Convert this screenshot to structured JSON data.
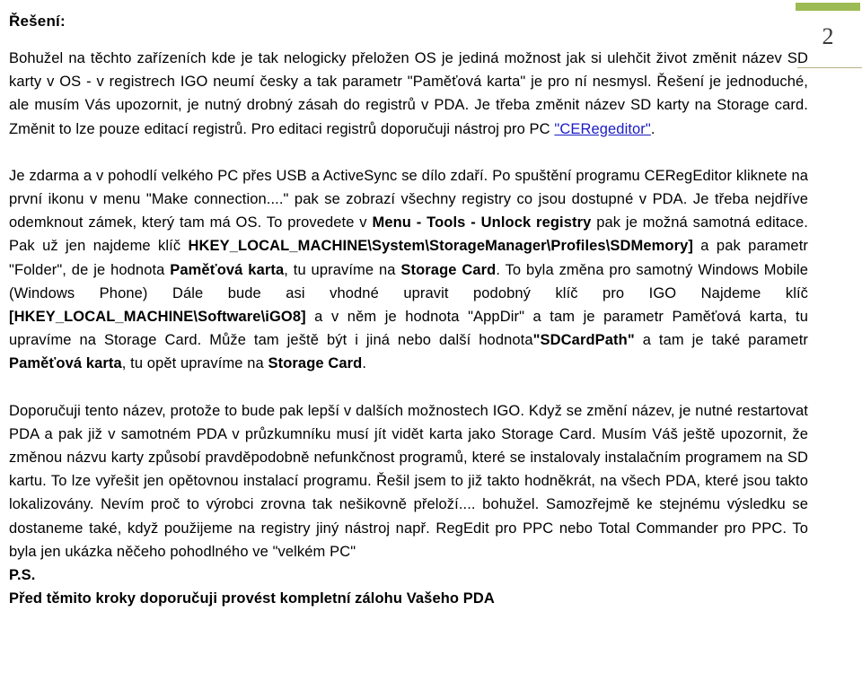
{
  "document": {
    "heading": "Řešení:",
    "page_number": "2",
    "accent_color": "#9dbb54",
    "link_color": "#1b1bc4",
    "rule_color": "#b3b288"
  },
  "paragraphs": {
    "p1_a": "Bohužel na těchto zařízeních kde je tak nelogicky přeložen OS je jediná možnost jak si ulehčit život změnit název SD karty v OS - v registrech IGO neumí česky a tak parametr \"Paměťová karta\" je pro ní nesmysl. Řešení je jednoduché, ale musím Vás upozornit, je nutný drobný zásah do registrů v PDA. Je třeba změnit název SD karty na Storage card. Změnit to lze pouze editací registrů. Pro editaci registrů doporučuji nástroj pro PC",
    "p1_link": "\"CERegeditor\"",
    "p1_b": ".",
    "p2_a": "Je zdarma a v pohodlí velkého PC přes USB a ActiveSync se dílo zdaří. Po spuštění programu CERegEditor kliknete na první ikonu v menu \"Make connection....\" pak se zobrazí všechny registry co jsou dostupné v PDA. Je třeba nejdříve odemknout zámek, který tam má OS. To provedete v ",
    "p2_bold1": "Menu - Tools - Unlock registry",
    "p2_b": " pak je možná samotná editace. Pak už jen najdeme klíč ",
    "p2_bold2": "HKEY_LOCAL_MACHINE\\System\\StorageManager\\Profiles\\SDMemory]",
    "p2_c": " a pak parametr \"Folder\", de je hodnota ",
    "p2_bold3": "Paměťová karta",
    "p2_d": ", tu upravíme na ",
    "p2_bold4": "Storage Card",
    "p2_e": ". To byla změna pro samotný Windows Mobile (Windows Phone) Dále bude asi vhodné upravit podobný klíč pro IGO Najdeme klíč ",
    "p2_bold5": "[HKEY_LOCAL_MACHINE\\Software\\iGO8]",
    "p2_f": " a v něm je hodnota \"AppDir\" a tam je parametr Paměťová karta, tu upravíme na Storage Card. Může tam ještě být i jiná nebo další hodnota",
    "p2_bold6": "\"SDCardPath\"",
    "p2_g": " a tam je také parametr ",
    "p2_bold7": "Paměťová karta",
    "p2_h": ", tu opět upravíme na ",
    "p2_bold8": "Storage Card",
    "p2_i": ".",
    "p3": "Doporučuji tento název, protože to bude pak lepší v dalších možnostech IGO. Když se změní název, je nutné restartovat PDA a pak již v samotném PDA v průzkumníku musí jít vidět karta jako Storage Card. Musím Váš ještě upozornit, že změnou názvu karty způsobí pravděpodobně nefunkčnost programů, které se instalovaly instalačním programem na SD kartu. To lze vyřešit jen opětovnou instalací programu. Řešil jsem to již takto hodněkrát, na všech PDA, které jsou takto lokalizovány. Nevím proč to výrobci zrovna tak nešikovně přeloží.... bohužel. Samozřejmě ke stejnému výsledku se dostaneme také, když použijeme na registry jiný nástroj např. RegEdit pro PPC nebo Total Commander pro PPC. To byla jen ukázka něčeho pohodlného ve \"velkém PC\"",
    "ps_label": "P.S.",
    "ps_text": "Před těmito kroky doporučuji provést kompletní zálohu Vašeho PDA"
  }
}
